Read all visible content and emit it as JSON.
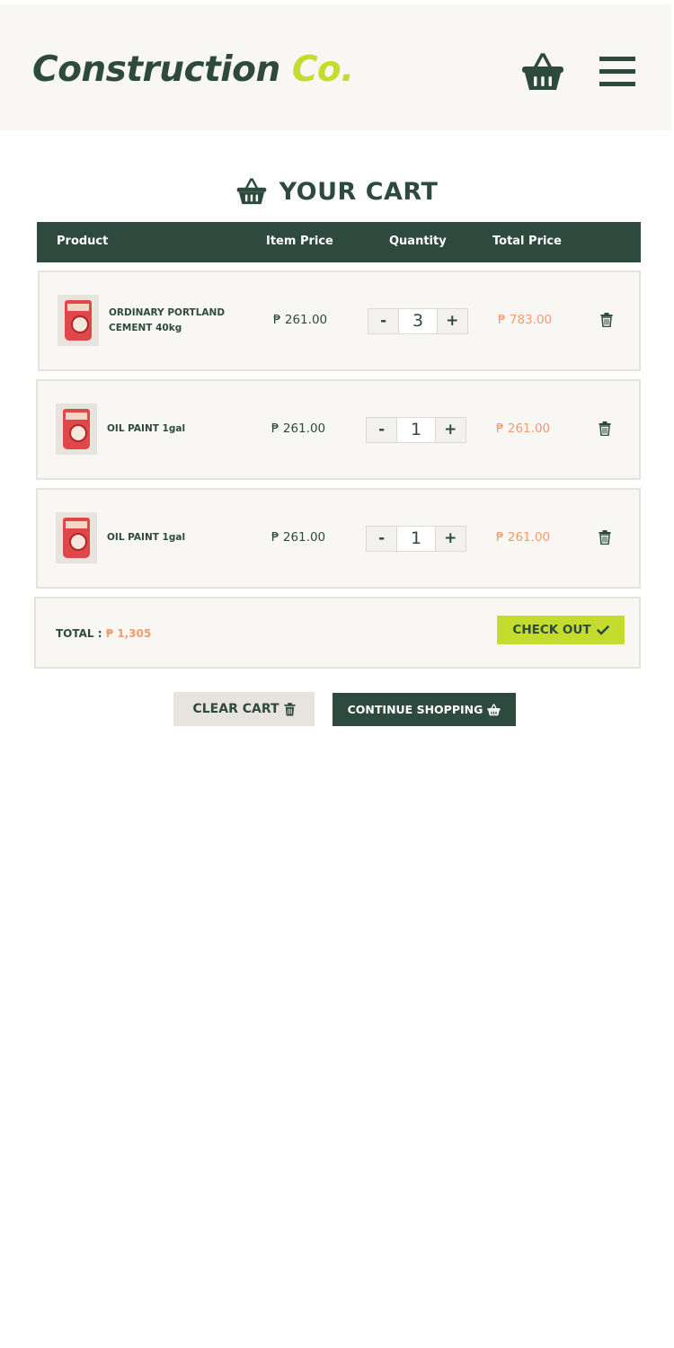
{
  "brand": {
    "name": "Construction",
    "suffix": "Co."
  },
  "header": {
    "cart_icon": "basket-icon",
    "menu_icon": "hamburger-menu-icon"
  },
  "page": {
    "title": "YOUR CART",
    "title_icon": "basket-icon"
  },
  "table": {
    "headers": {
      "product": "Product",
      "item_price": "Item Price",
      "quantity": "Quantity",
      "total_price": "Total Price"
    }
  },
  "cart": {
    "items": [
      {
        "name_line1": "ORDINARY PORTLAND",
        "name_line2": "CEMENT 40kg",
        "item_price": "₱ 261.00",
        "quantity": "3",
        "total_price": "₱ 783.00",
        "minus": "-",
        "plus": "+"
      },
      {
        "name_line1": "OIL PAINT 1gal",
        "name_line2": "",
        "item_price": "₱ 261.00",
        "quantity": "1",
        "total_price": "₱ 261.00",
        "minus": "-",
        "plus": "+"
      },
      {
        "name_line1": "OIL PAINT 1gal",
        "name_line2": "",
        "item_price": "₱ 261.00",
        "quantity": "1",
        "total_price": "₱ 261.00",
        "minus": "-",
        "plus": "+"
      }
    ],
    "delete_icon": "trash-icon"
  },
  "summary": {
    "total_label": "TOTAL :",
    "total_value": "₱ 1,305",
    "checkout_label": "CHECK OUT",
    "checkout_icon": "check-icon"
  },
  "actions": {
    "clear_label": "CLEAR CART",
    "clear_icon": "trash-icon",
    "continue_label": "CONTINUE SHOPPING",
    "continue_icon": "basket-icon"
  },
  "colors": {
    "primary": "#2e4a3f",
    "accent": "#c3dc2d",
    "price": "#f49a6c",
    "panel": "#f8f7f4",
    "border": "#e6e3de"
  }
}
